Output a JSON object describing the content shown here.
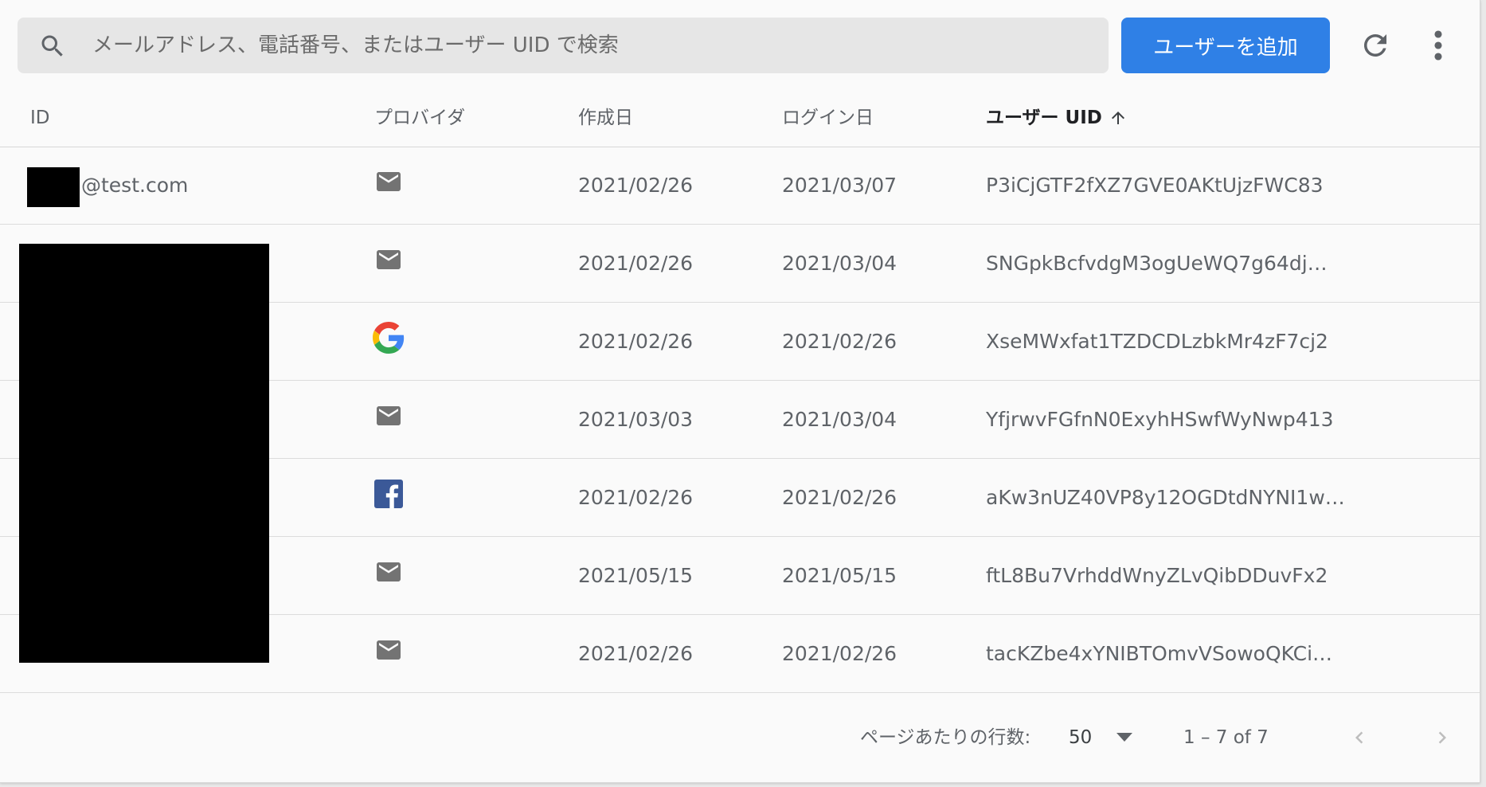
{
  "search": {
    "placeholder": "メールアドレス、電話番号、またはユーザー UID で検索",
    "icon": "search-icon"
  },
  "toolbar": {
    "add_user_label": "ユーザーを追加",
    "refresh_icon": "refresh-icon",
    "more_icon": "more-vert-icon"
  },
  "columns": {
    "id": "ID",
    "provider": "プロバイダ",
    "created": "作成日",
    "signed_in": "ログイン日",
    "uid": "ユーザー UID"
  },
  "sort": {
    "column": "uid",
    "direction": "ascending",
    "icon": "arrow-upward-icon"
  },
  "rows": [
    {
      "id_text": "@test.com",
      "provider": "email-icon",
      "created": "2021/02/26",
      "signed_in": "2021/03/07",
      "uid": "P3iCjGTF2fXZ7GVE0AKtUjzFWC83"
    },
    {
      "id_text": "",
      "provider": "email-icon",
      "created": "2021/02/26",
      "signed_in": "2021/03/04",
      "uid": "SNGpkBcfvdgM3ogUeWQ7g64dj…"
    },
    {
      "id_text": "",
      "provider": "google-icon",
      "created": "2021/02/26",
      "signed_in": "2021/02/26",
      "uid": "XseMWxfat1TZDCDLzbkMr4zF7cj2"
    },
    {
      "id_text": "",
      "provider": "email-icon",
      "created": "2021/03/03",
      "signed_in": "2021/03/04",
      "uid": "YfjrwvFGfnN0ExyhHSwfWyNwp413"
    },
    {
      "id_text": "",
      "provider": "facebook-icon",
      "created": "2021/02/26",
      "signed_in": "2021/02/26",
      "uid": "aKw3nUZ40VP8y12OGDtdNYNI1w…"
    },
    {
      "id_text": "",
      "provider": "email-icon",
      "created": "2021/05/15",
      "signed_in": "2021/05/15",
      "uid": "ftL8Bu7VrhddWnyZLvQibDDuvFx2"
    },
    {
      "id_text": "",
      "provider": "email-icon",
      "created": "2021/02/26",
      "signed_in": "2021/02/26",
      "uid": "tacKZbe4xYNIBTOmvVSowoQKCi…"
    }
  ],
  "pagination": {
    "rows_per_page_label": "ページあたりの行数:",
    "rows_per_page_value": "50",
    "range": "1 – 7 of 7",
    "prev_icon": "chevron-left-icon",
    "next_icon": "chevron-right-icon"
  },
  "colors": {
    "primary": "#2f80e6",
    "icon_gray": "#737373",
    "google_blue": "#4285F4",
    "google_red": "#EA4335",
    "google_yellow": "#FBBC05",
    "google_green": "#34A853",
    "facebook_blue": "#3b5998"
  }
}
